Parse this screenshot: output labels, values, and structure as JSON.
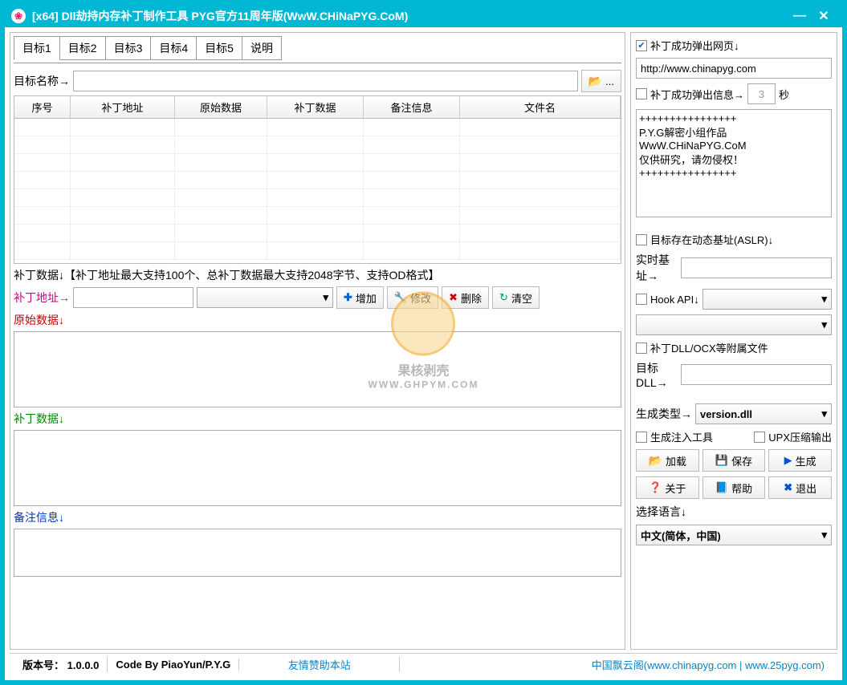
{
  "titlebar": {
    "title": "[x64]  Dll劫持内存补丁制作工具   PYG官方11周年版(WwW.CHiNaPYG.CoM)"
  },
  "tabs": [
    "目标1",
    "目标2",
    "目标3",
    "目标4",
    "目标5",
    "说明"
  ],
  "target_name_label": "目标名称→",
  "browse_tip": "...",
  "table_headers": {
    "seq": "序号",
    "addr": "补丁地址",
    "orig": "原始数据",
    "patch": "补丁数据",
    "memo": "备注信息",
    "file": "文件名"
  },
  "patch_data_info": "补丁数据↓【补丁地址最大支持100个、总补丁数据最大支持2048字节、支持OD格式】",
  "patch_addr_label": "补丁地址→",
  "btn_add": "增加",
  "btn_modify": "修改",
  "btn_delete": "删除",
  "btn_clear": "清空",
  "orig_data_label": "原始数据↓",
  "patch_data_label": "补丁数据↓",
  "memo_label": "备注信息↓",
  "right": {
    "popup_web_label": "补丁成功弹出网页↓",
    "popup_web_url": "http://www.chinapyg.com",
    "popup_msg_label": "补丁成功弹出信息→",
    "popup_msg_sec": "3",
    "popup_msg_unit": "秒",
    "popup_msg_text": "++++++++++++++++\nP.Y.G解密小组作品\nWwW.CHiNaPYG.CoM\n仅供研究，请勿侵权！\n++++++++++++++++",
    "aslr_label": "目标存在动态基址(ASLR)↓",
    "realtime_base_label": "实时基址→",
    "hook_api_label": "Hook API↓",
    "patch_dll_label": "补丁DLL/OCX等附属文件",
    "target_dll_label": "目标DLL→",
    "gen_type_label": "生成类型→",
    "gen_type_value": "version.dll",
    "gen_inject_label": "生成注入工具",
    "upx_label": "UPX压缩输出",
    "btn_load": "加载",
    "btn_save": "保存",
    "btn_gen": "生成",
    "btn_about": "关于",
    "btn_help": "帮助",
    "btn_exit": "退出",
    "lang_label": "选择语言↓",
    "lang_value": "中文(简体，中国)"
  },
  "status": {
    "version_label": "版本号：",
    "version": "1.0.0.0",
    "author": "Code By PiaoYun/P.Y.G",
    "sponsor": "友情赞助本站",
    "site_prefix": "中国飘云阁(",
    "site1": "www.chinapyg.com",
    "site_sep": " | ",
    "site2": "www.25pyg.com",
    "site_suffix": ")"
  },
  "watermark": {
    "line1": "果核剥壳",
    "line2": "WWW.GHPYM.COM"
  }
}
